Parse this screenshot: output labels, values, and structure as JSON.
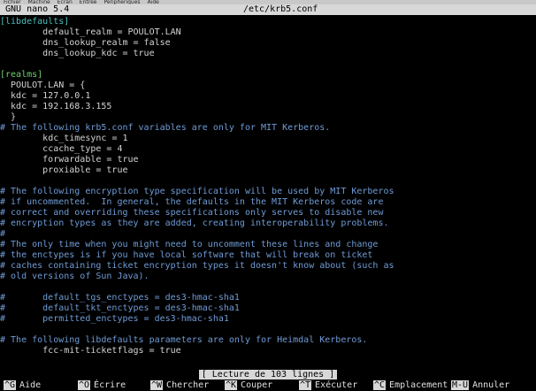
{
  "menubar": {
    "items": [
      "Fichier",
      "Machine",
      "Écran",
      "Entrée",
      "Périphériques",
      "Aide"
    ]
  },
  "titlebar": {
    "program": "GNU nano 5.4",
    "filename": "/etc/krb5.conf"
  },
  "editor": {
    "lines": [
      {
        "segments": [
          {
            "t": "[libdefaults]",
            "c": "s"
          }
        ]
      },
      {
        "segments": [
          {
            "t": "        ",
            "c": "ws"
          },
          {
            "t": "default_realm = POULOT.LAN",
            "c": "e"
          }
        ]
      },
      {
        "segments": [
          {
            "t": "        ",
            "c": "ws"
          },
          {
            "t": "dns_lookup_realm = false",
            "c": "e"
          }
        ]
      },
      {
        "segments": [
          {
            "t": "        ",
            "c": "ws"
          },
          {
            "t": "dns_lookup_kdc = true",
            "c": "e"
          }
        ]
      },
      {
        "segments": []
      },
      {
        "segments": [
          {
            "t": "[realms]",
            "c": "k"
          }
        ]
      },
      {
        "segments": [
          {
            "t": "  POULOT.LAN = {",
            "c": "e"
          }
        ]
      },
      {
        "segments": [
          {
            "t": "  kdc = 127.0.0.1",
            "c": "e"
          }
        ]
      },
      {
        "segments": [
          {
            "t": "  kdc = 192.168.3.155",
            "c": "e"
          }
        ]
      },
      {
        "segments": [
          {
            "t": "  }",
            "c": "e"
          }
        ]
      },
      {
        "segments": [
          {
            "t": "# The following krb5.conf variables are only for MIT Kerberos.",
            "c": "c"
          }
        ]
      },
      {
        "segments": [
          {
            "t": "        ",
            "c": "ws"
          },
          {
            "t": "kdc_timesync = 1",
            "c": "e"
          }
        ]
      },
      {
        "segments": [
          {
            "t": "        ",
            "c": "ws"
          },
          {
            "t": "ccache_type = 4",
            "c": "e"
          }
        ]
      },
      {
        "segments": [
          {
            "t": "        forwardable = true",
            "c": "e"
          }
        ]
      },
      {
        "segments": [
          {
            "t": "        proxiable = true",
            "c": "e"
          }
        ]
      },
      {
        "segments": []
      },
      {
        "segments": [
          {
            "t": "# The following encryption type specification will be used by MIT Kerberos",
            "c": "c"
          }
        ]
      },
      {
        "segments": [
          {
            "t": "# if uncommented.  In general, the defaults in the MIT Kerberos code are",
            "c": "c"
          }
        ]
      },
      {
        "segments": [
          {
            "t": "# correct and overriding these specifications only serves to disable new",
            "c": "c"
          }
        ]
      },
      {
        "segments": [
          {
            "t": "# encryption types as they are added, creating interoperability problems.",
            "c": "c"
          }
        ]
      },
      {
        "segments": [
          {
            "t": "#",
            "c": "c"
          }
        ]
      },
      {
        "segments": [
          {
            "t": "# The only time when you might need to uncomment these lines and change",
            "c": "c"
          }
        ]
      },
      {
        "segments": [
          {
            "t": "# the enctypes is if you have local software that will break on ticket",
            "c": "c"
          }
        ]
      },
      {
        "segments": [
          {
            "t": "# caches containing ticket encryption types it doesn't know about (such as",
            "c": "c"
          }
        ]
      },
      {
        "segments": [
          {
            "t": "# old versions of Sun Java).",
            "c": "c"
          }
        ]
      },
      {
        "segments": []
      },
      {
        "segments": [
          {
            "t": "#       default_tgs_enctypes = des3-hmac-sha1",
            "c": "c"
          }
        ]
      },
      {
        "segments": [
          {
            "t": "#       default_tkt_enctypes = des3-hmac-sha1",
            "c": "c"
          }
        ]
      },
      {
        "segments": [
          {
            "t": "#       permitted_enctypes = des3-hmac-sha1",
            "c": "c"
          }
        ]
      },
      {
        "segments": []
      },
      {
        "segments": [
          {
            "t": "# The following libdefaults parameters are only for Heimdal Kerberos.",
            "c": "c"
          }
        ]
      },
      {
        "segments": [
          {
            "t": "        fcc-mit-ticketflags = true",
            "c": "e"
          }
        ]
      }
    ]
  },
  "status": {
    "message": "[ Lecture de 103 lignes ]"
  },
  "shortcuts": [
    {
      "key": "^G",
      "label": "Aide"
    },
    {
      "key": "^O",
      "label": "Écrire"
    },
    {
      "key": "^W",
      "label": "Chercher"
    },
    {
      "key": "^K",
      "label": "Couper"
    },
    {
      "key": "^T",
      "label": "Exécuter"
    },
    {
      "key": "^C",
      "label": "Emplacement"
    },
    {
      "key": "M-U",
      "label": "Annuler"
    }
  ]
}
